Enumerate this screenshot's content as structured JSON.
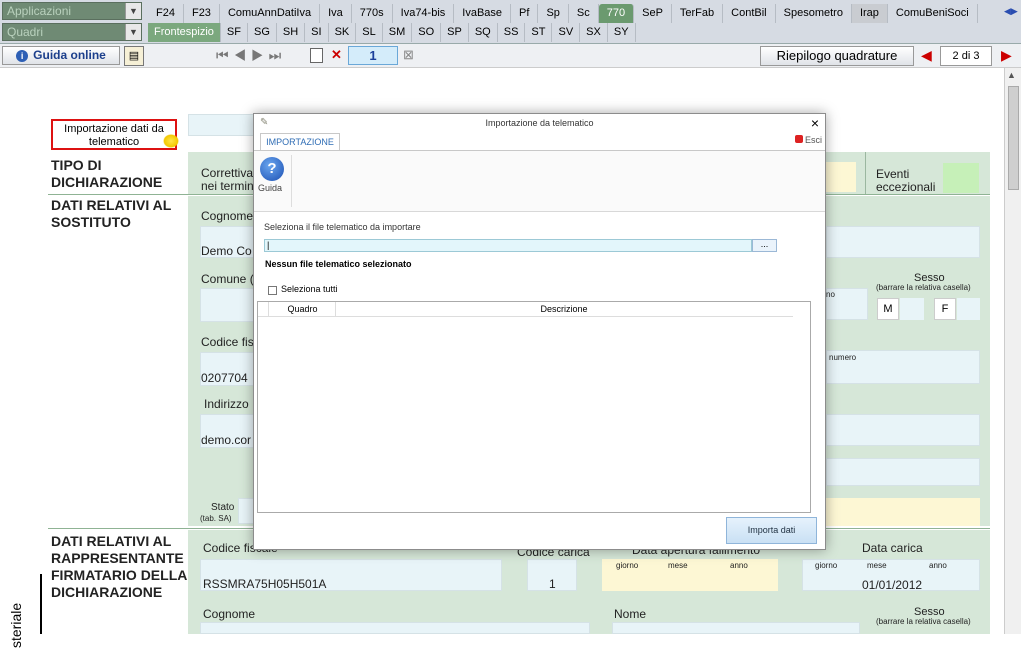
{
  "top": {
    "app_combo": "Applicazioni",
    "quadri_combo": "Quadri",
    "tabs": [
      "F24",
      "F23",
      "ComuAnnDatiIva",
      "Iva",
      "770s",
      "Iva74-bis",
      "IvaBase",
      "Pf",
      "Sp",
      "Sc",
      "770",
      "SeP",
      "TerFab",
      "ContBil",
      "Spesometro",
      "Irap",
      "ComuBeniSoci"
    ],
    "subtabs": [
      "Frontespizio",
      "SF",
      "SG",
      "SH",
      "SI",
      "SK",
      "SL",
      "SM",
      "SO",
      "SP",
      "SQ",
      "SS",
      "ST",
      "SV",
      "SX",
      "SY"
    ]
  },
  "toolbar": {
    "guida_label": "Guida online",
    "page_number": "1",
    "riepilogo_label": "Riepilogo quadrature",
    "page_count": "2 di 3"
  },
  "form": {
    "import_btn": "Importazione dati da telematico",
    "tipo_dich": "TIPO DI DICHIARAZIONE",
    "correttiva": "Correttiva nei termini",
    "eventi": "Eventi eccezionali",
    "dati_sostituto": "DATI RELATIVI AL SOSTITUTO",
    "cognome": "Cognome o",
    "cognome_val": "Demo Co",
    "comune": "Comune (o",
    "sesso": "Sesso",
    "sesso_hint": "(barrare la relativa casella)",
    "no": "no",
    "m": "M",
    "f": "F",
    "codice_fisc": "Codice fisc",
    "codice_val": "0207704",
    "numero": "numero",
    "indirizzo": "Indirizzo",
    "indirizzo_val": "demo.cor",
    "stato": "Stato",
    "tab_sa": "(tab. SA)",
    "dati_rapp": "DATI RELATIVI AL RAPPRESENTANTE FIRMATARIO DELLA DICHIARAZIONE",
    "codice_fiscale": "Codice fiscale",
    "cf_val": "RSSMRA75H05H501A",
    "codice_carica": "Codice carica",
    "carica_val": "1",
    "data_apertura": "Data apertura fallimento",
    "giorno": "giorno",
    "mese": "mese",
    "anno": "anno",
    "data_carica": "Data carica",
    "data_carica_val": "01/01/2012",
    "cognome2": "Cognome",
    "nome": "Nome",
    "sesso2": "Sesso",
    "sesso2_hint": "(barrare la relativa casella)",
    "side_text": "steriale"
  },
  "dialog": {
    "title": "Importazione da telematico",
    "tab": "IMPORTAZIONE",
    "esci": "Esci",
    "guida": "Guida",
    "select_label": "Seleziona il file telematico da importare",
    "browse": "...",
    "no_file": "Nessun file telematico selezionato",
    "select_all": "Seleziona tutti",
    "col_quadro": "Quadro",
    "col_desc": "Descrizione",
    "importa": "Importa dati",
    "close": "×"
  }
}
